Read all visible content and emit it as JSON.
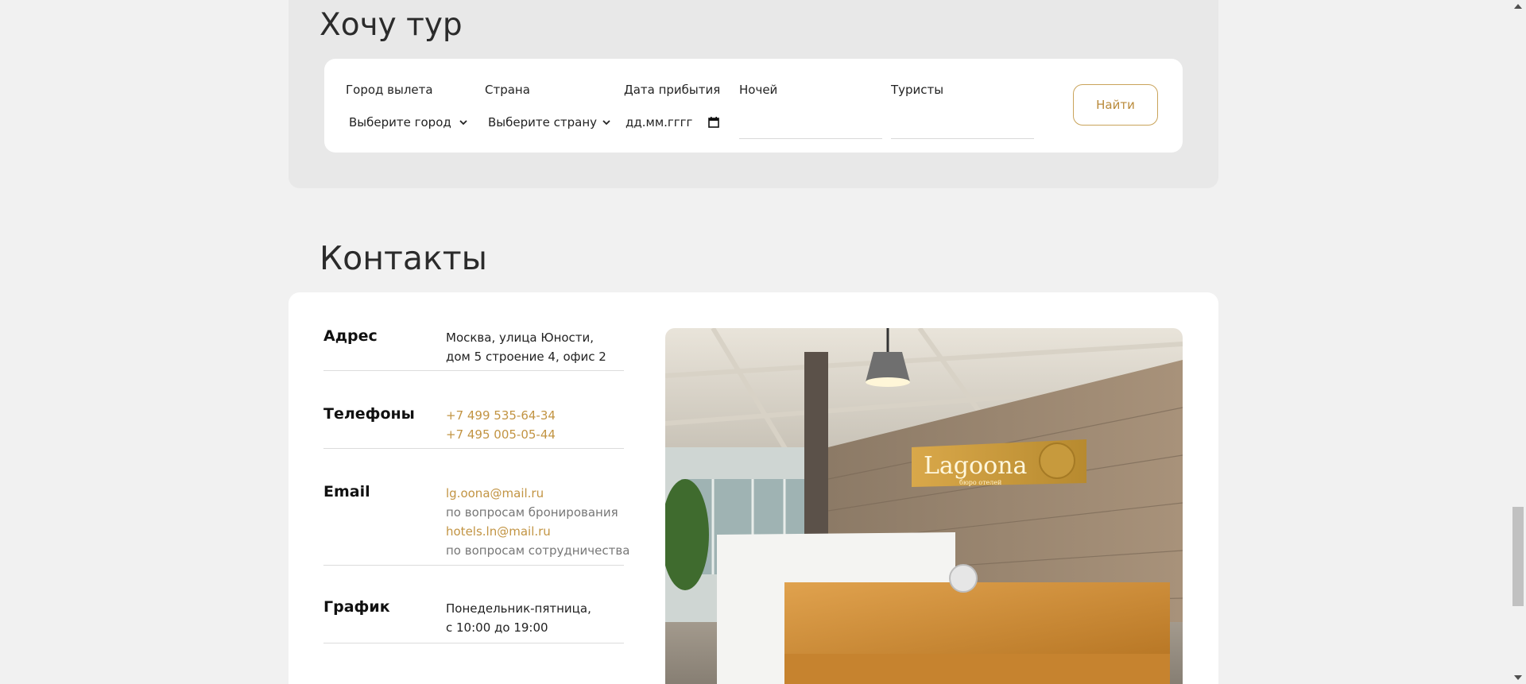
{
  "tour": {
    "title": "Хочу тур",
    "city_label": "Город вылета",
    "city_value": "Выберите город",
    "country_label": "Страна",
    "country_value": "Выберите страну",
    "date_label": "Дата прибытия",
    "date_value": "дд.мм.гггг",
    "nights_label": "Ночей",
    "nights_value": "",
    "tourists_label": "Туристы",
    "tourists_value": "",
    "find_label": "Найти"
  },
  "contacts": {
    "title": "Контакты",
    "address_label": "Адрес",
    "address_line1": "Москва, улица Юности,",
    "address_line2": "дом 5 строение 4, офис 2",
    "phones_label": "Телефоны",
    "phone1": "+7 499 535-64-34",
    "phone2": "+7 495 005-05-44",
    "email_label": "Email",
    "email1": "lg.oona@mail.ru",
    "email1_note": "по вопросам бронирования",
    "email2": "hotels.ln@mail.ru",
    "email2_note": "по вопросам сотрудничества",
    "schedule_label": "График",
    "schedule_line1": "Понедельник-пятница,",
    "schedule_line2": "с 10:00 до 19:00",
    "photo_sign": "Lagoona",
    "photo_sign_sub": "бюро отелей"
  },
  "colors": {
    "accent": "#c29443",
    "section_bg": "#e8e8e8",
    "page_bg": "#f1f1f1"
  },
  "icons": {
    "select_arrow": "chevron-down-icon",
    "date_picker": "calendar-icon"
  }
}
